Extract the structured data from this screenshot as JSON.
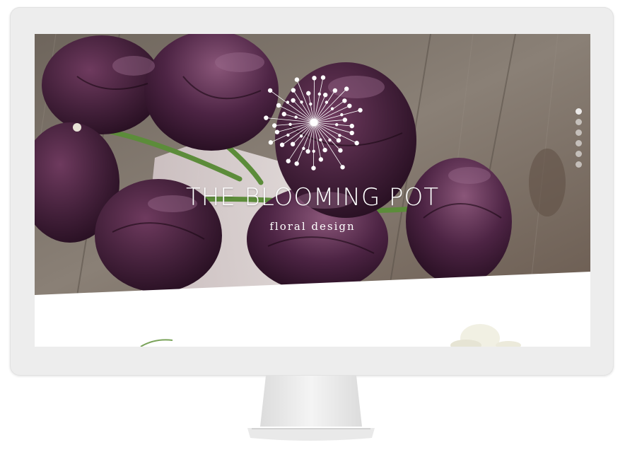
{
  "site": {
    "title": "THE BLOOMING POT",
    "subtitle": "floral design"
  },
  "slider": {
    "slide_count": 6,
    "active_index": 0
  },
  "icons": {
    "logo": "dandelion-logo-icon"
  },
  "colors": {
    "frame": "#ededed",
    "wood": "#7d746b",
    "tulip": "#3d1a32",
    "stem": "#5c8c3a"
  }
}
